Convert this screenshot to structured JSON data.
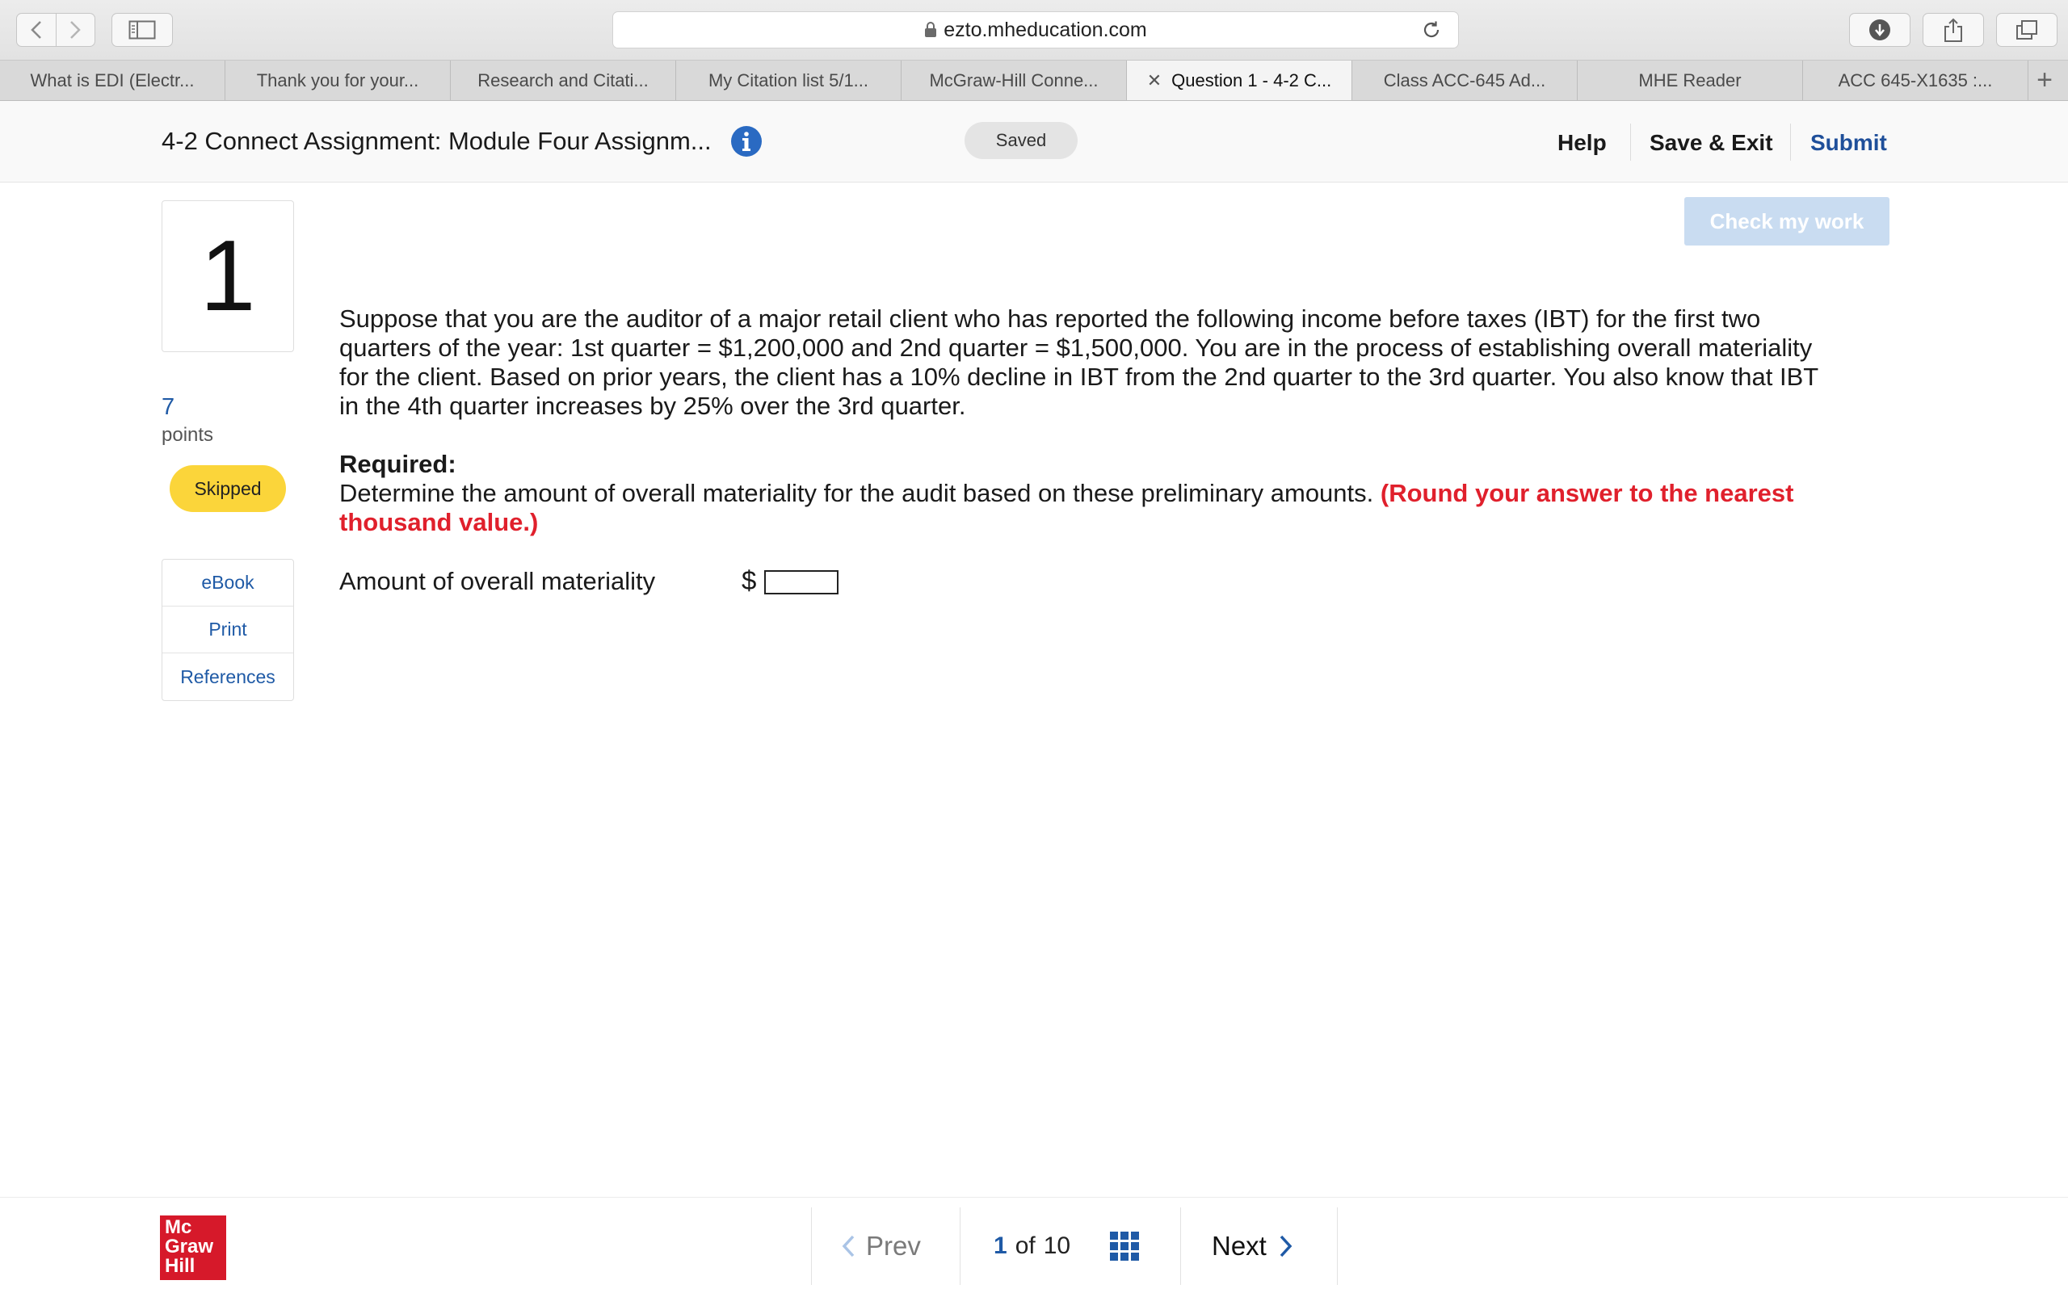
{
  "browser": {
    "url": "ezto.mheducation.com",
    "tabs": [
      {
        "label": "What is EDI (Electr...",
        "active": false
      },
      {
        "label": "Thank you for your...",
        "active": false
      },
      {
        "label": "Research and Citati...",
        "active": false
      },
      {
        "label": "My Citation list 5/1...",
        "active": false
      },
      {
        "label": "McGraw-Hill Conne...",
        "active": false
      },
      {
        "label": "Question 1 - 4-2 C...",
        "active": true
      },
      {
        "label": "Class ACC-645 Ad...",
        "active": false
      },
      {
        "label": "MHE Reader",
        "active": false
      },
      {
        "label": "ACC 645-X1635 :...",
        "active": false
      }
    ]
  },
  "header": {
    "title": "4-2 Connect Assignment: Module Four Assignm...",
    "status": "Saved",
    "help": "Help",
    "save_exit": "Save & Exit",
    "submit": "Submit"
  },
  "question": {
    "number": "1",
    "points_value": "7",
    "points_label": "points",
    "status_badge": "Skipped",
    "check_work": "Check my work",
    "prompt": "Suppose that you are the auditor of a major retail client who has reported the following income before taxes (IBT) for the first two quarters of the year: 1st quarter = $1,200,000 and 2nd quarter = $1,500,000. You are in the process of establishing overall materiality for the client. Based on prior years, the client has a 10% decline in IBT from the 2nd quarter to the 3rd quarter. You also know that IBT in the 4th quarter increases by 25% over the 3rd quarter.",
    "required_label": "Required:",
    "required_text": "Determine the amount of overall materiality for the audit based on these preliminary amounts. ",
    "required_hint": "(Round your answer to the nearest thousand value.)",
    "answer_label": "Amount of overall materiality",
    "currency": "$",
    "answer_value": ""
  },
  "resources": {
    "ebook": "eBook",
    "print": "Print",
    "references": "References"
  },
  "footer": {
    "logo_lines": [
      "Mc",
      "Graw",
      "Hill"
    ],
    "prev": "Prev",
    "current_page": "1",
    "of": "of",
    "total_pages": "10",
    "next": "Next"
  },
  "colors": {
    "accent_blue": "#1f5aa6",
    "hint_red": "#e0202c",
    "skipped_yellow": "#fbd53a",
    "logo_red": "#d6192a"
  }
}
